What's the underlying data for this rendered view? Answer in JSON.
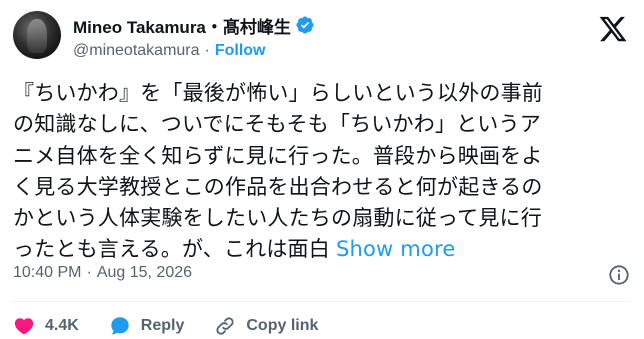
{
  "user": {
    "display_name": "Mineo Takamura・髙村峰生",
    "handle": "@mineotakamura",
    "separator": "·",
    "follow_label": "Follow"
  },
  "tweet": {
    "lines": [
      "『ちいかわ』を「最後が怖い」らしいという以外の事前",
      "の知識なしに、ついでにそもそも「ちいかわ」というア",
      "ニメ自体を全く知らずに見に行った。普段から映画をよ",
      "く見る大学教授とこの作品を出合わせると何が起きるの",
      "かという人体実験をしたい人たちの扇動に従って見に行",
      "ったとも言える。が、これは面白"
    ],
    "show_more": "Show more"
  },
  "meta": {
    "time": "10:40 PM",
    "separator": "·",
    "date": "Aug 15, 2026"
  },
  "actions": {
    "like_count": "4.4K",
    "reply_label": "Reply",
    "copy_link_label": "Copy link"
  },
  "colors": {
    "accent": "#1d9bf0",
    "like": "#f91880",
    "muted": "#536471",
    "text": "#0f1419"
  },
  "icons": [
    "verified-badge-icon",
    "x-logo-icon",
    "info-icon",
    "heart-icon",
    "reply-bubble-icon",
    "link-icon"
  ]
}
